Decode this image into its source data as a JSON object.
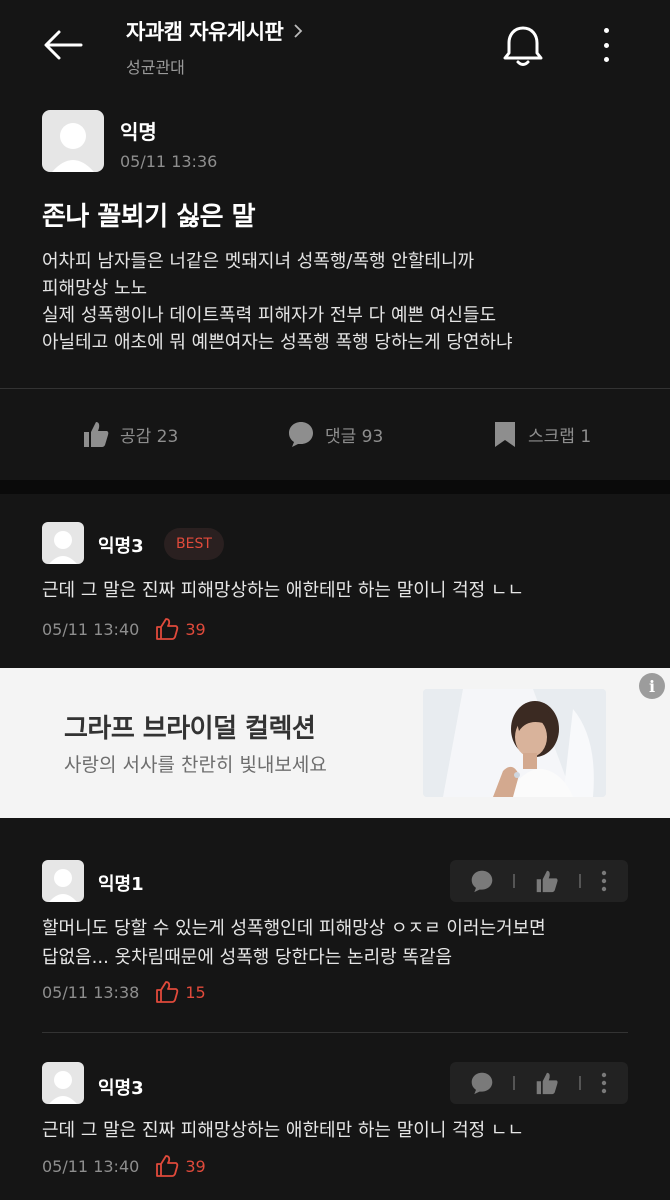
{
  "header": {
    "board_title": "자과캠 자유게시판",
    "board_subtitle": "성균관대"
  },
  "post": {
    "author": "익명",
    "time": "05/11 13:36",
    "title": "존나 꼴뵈기 싫은 말",
    "body_lines": [
      "어차피 남자들은 너같은 멧돼지녀 성폭행/폭행 안할테니까",
      "피해망상 노노",
      "실제 성폭행이나 데이트폭력 피해자가 전부 다 예쁜 여신들도",
      "아닐테고 애초에 뭐 예쁜여자는 성폭행 폭행 당하는게 당연하냐"
    ],
    "actions": {
      "like_label": "공감 23",
      "comment_label": "댓글 93",
      "scrap_label": "스크랩 1"
    }
  },
  "comments": [
    {
      "author": "익명3",
      "badge": "BEST",
      "text_lines": [
        "근데 그 말은 진짜 피해망상하는 애한테만 하는 말이니 걱정 ㄴㄴ"
      ],
      "time": "05/11 13:40",
      "likes": "39"
    },
    {
      "author": "익명1",
      "text_lines": [
        "할머니도 당할 수 있는게 성폭행인데 피해망상 ㅇㅈㄹ 이러는거보면",
        "답없음... 옷차림때문에 성폭행 당한다는 논리랑 똑같음"
      ],
      "time": "05/11 13:38",
      "likes": "15"
    },
    {
      "author": "익명3",
      "text_lines": [
        "근데 그 말은 진짜 피해망상하는 애한테만 하는 말이니 걱정 ㄴㄴ"
      ],
      "time": "05/11 13:40",
      "likes": "39"
    }
  ],
  "ad": {
    "title": "그라프 브라이덜 컬렉션",
    "subtitle": "사랑의 서사를 찬란히 빛내보세요",
    "info_icon": "i"
  },
  "colors": {
    "background": "#151515",
    "accent_red": "#e04a3b",
    "muted": "#8e8e8e"
  }
}
